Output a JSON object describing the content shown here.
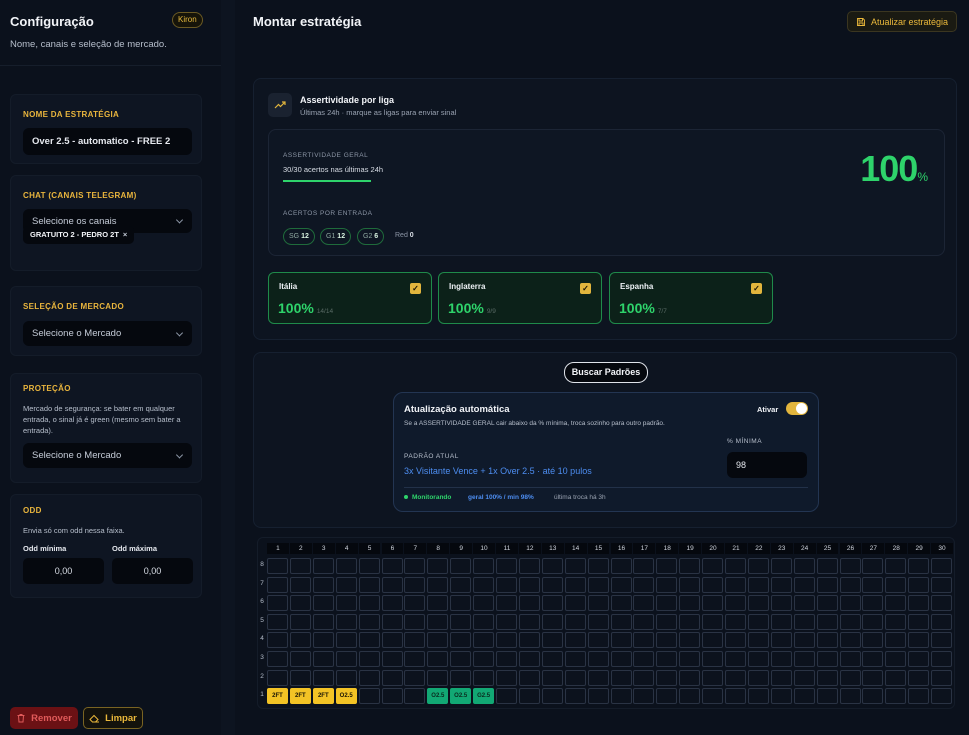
{
  "sidebar": {
    "title": "Configuração",
    "badge": "Kiron",
    "subtitle": "Nome, canais e seleção de mercado.",
    "name": {
      "label": "NOME DA ESTRATÉGIA",
      "value": "Over 2.5 - automatico - FREE 2"
    },
    "chat": {
      "label": "CHAT (CANAIS TELEGRAM)",
      "placeholder": "Selecione os canais",
      "chip": "GRATUITO 2 - PEDRO 2T",
      "chip_remove": "×"
    },
    "market": {
      "label": "SELEÇÃO DE MERCADO",
      "placeholder": "Selecione o Mercado"
    },
    "protection": {
      "label": "PROTEÇÃO",
      "text": "Mercado de segurança: se bater em qualquer entrada, o sinal já é green (mesmo sem bater a entrada).",
      "placeholder": "Selecione o Mercado"
    },
    "odd": {
      "label": "ODD",
      "text": "Envia só com odd nessa faixa.",
      "min_label": "Odd mínima",
      "max_label": "Odd máxima",
      "min_value": "0,00",
      "max_value": "0,00"
    },
    "remove_label": "Remover",
    "clear_label": "Limpar"
  },
  "main": {
    "title": "Montar estratégia",
    "update_label": "Atualizar estratégia",
    "league_panel": {
      "title": "Assertividade por liga",
      "subtitle": "Últimas 24h · marque as ligas para enviar sinal",
      "general_label": "ASSERTIVIDADE GERAL",
      "general_text": "30/30 acertos nas últimas 24h",
      "general_value": "100",
      "general_pct": "%",
      "general_progress": 1.0,
      "entries_label": "ACERTOS POR ENTRADA",
      "entries": [
        {
          "k": "SG",
          "v": "12"
        },
        {
          "k": "G1",
          "v": "12"
        },
        {
          "k": "G2",
          "v": "6"
        }
      ],
      "red": {
        "k": "Red",
        "v": "0"
      },
      "leagues": [
        {
          "name": "Itália",
          "pct": "100%",
          "frac": "14/14",
          "checked": true
        },
        {
          "name": "Inglaterra",
          "pct": "100%",
          "frac": "9/9",
          "checked": true
        },
        {
          "name": "Espanha",
          "pct": "100%",
          "frac": "7/7",
          "checked": true
        }
      ]
    },
    "patterns": {
      "search_label": "Buscar Padrões",
      "auto_title": "Atualização automática",
      "activate_label": "Ativar",
      "toggle_on": true,
      "auto_desc": "Se a ASSERTIVIDADE GERAL cair abaixo da % mínima, troca sozinho para outro padrão.",
      "current_label": "PADRÃO ATUAL",
      "current_value": "3x Visitante Vence + 1x Over 2.5 · até 10 pulos",
      "min_label": "% MÍNIMA",
      "min_value": "98",
      "status": "Monitorando",
      "stats": "geral 100% / min 98%",
      "last_change": "última troca há 3h"
    },
    "grid": {
      "columns": [
        "1",
        "2",
        "3",
        "4",
        "5",
        "6",
        "7",
        "8",
        "9",
        "10",
        "11",
        "12",
        "13",
        "14",
        "15",
        "16",
        "17",
        "18",
        "19",
        "20",
        "21",
        "22",
        "23",
        "24",
        "25",
        "26",
        "27",
        "28",
        "29",
        "30"
      ],
      "rows": [
        "8",
        "7",
        "6",
        "5",
        "4",
        "3",
        "2",
        "1"
      ],
      "filled": [
        {
          "row": "1",
          "col": 1,
          "text": "2FT",
          "color": "#f3c325"
        },
        {
          "row": "1",
          "col": 2,
          "text": "2FT",
          "color": "#f3c325"
        },
        {
          "row": "1",
          "col": 3,
          "text": "2FT",
          "color": "#f3c325"
        },
        {
          "row": "1",
          "col": 4,
          "text": "O2.5",
          "color": "#f3c325"
        },
        {
          "row": "1",
          "col": 8,
          "text": "O2.5",
          "color": "#12a874"
        },
        {
          "row": "1",
          "col": 9,
          "text": "O2.5",
          "color": "#12a874"
        },
        {
          "row": "1",
          "col": 10,
          "text": "G2.5",
          "color": "#12a874"
        }
      ]
    }
  }
}
